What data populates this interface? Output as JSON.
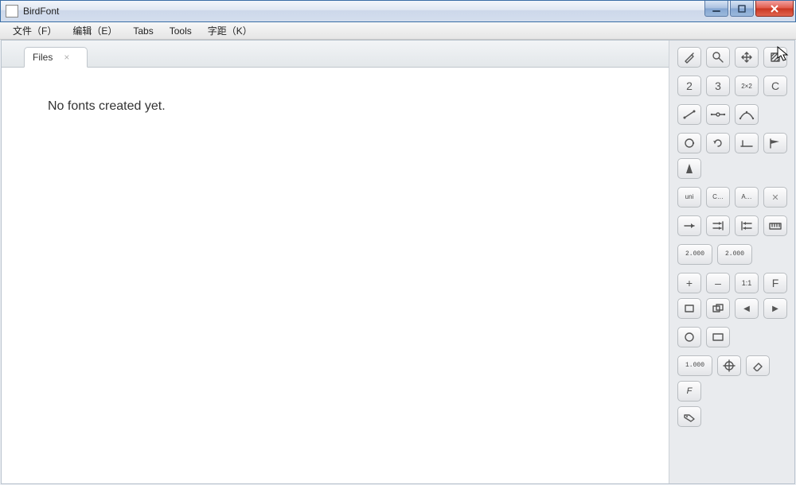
{
  "window": {
    "title": "BirdFont"
  },
  "menu": {
    "file": "文件（F）",
    "edit": "编辑（E）",
    "tabs": "Tabs",
    "tools": "Tools",
    "kerning": "字距（K）"
  },
  "tab": {
    "label": "Files",
    "close": "×"
  },
  "main": {
    "empty_message": "No fonts created yet."
  },
  "tools": {
    "row2": {
      "two": "2",
      "three": "3",
      "grid": "2×2",
      "c": "C"
    },
    "row7": {
      "uni": "uni",
      "cdots": "C…",
      "adots": "A…",
      "x": "✕"
    },
    "row9": {
      "val_a": "2.000",
      "val_b": "2.000"
    },
    "row10": {
      "plus": "+",
      "minus": "–",
      "ratio": "1:1",
      "f": "F"
    },
    "row11": {
      "prev": "◀",
      "next": "▶"
    },
    "row13": {
      "val": "1.000",
      "f_italic": "F"
    }
  }
}
